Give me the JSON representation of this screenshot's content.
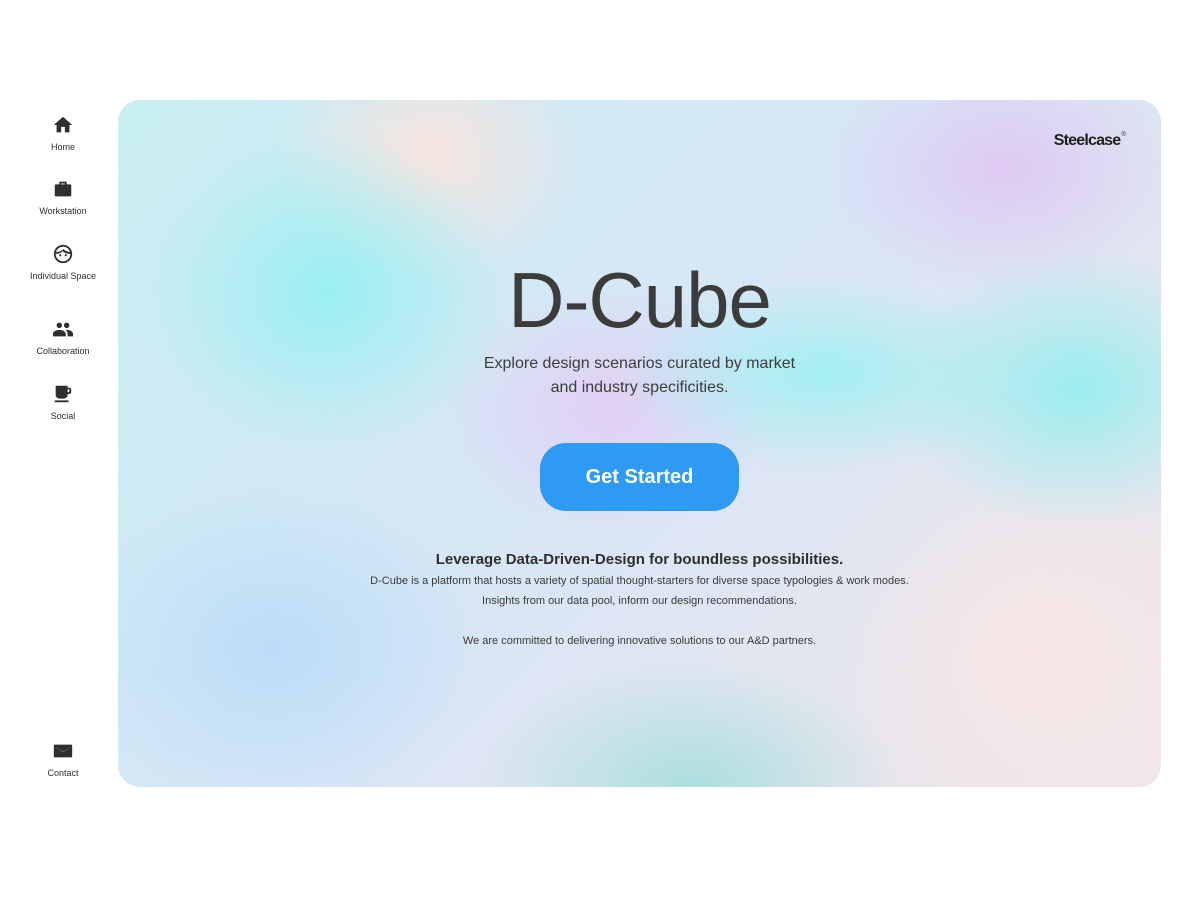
{
  "sidebar": {
    "items": [
      {
        "label": "Home",
        "icon": "home-icon"
      },
      {
        "label": "Workstation",
        "icon": "briefcase-icon"
      },
      {
        "label": "Individual Space",
        "icon": "face-icon"
      },
      {
        "label": "Collaboration",
        "icon": "people-icon"
      },
      {
        "label": "Social",
        "icon": "coffee-icon"
      }
    ],
    "contact": {
      "label": "Contact",
      "icon": "mail-icon"
    }
  },
  "hero": {
    "brand": "Steelcase",
    "brand_mark": "®",
    "title": "D-Cube",
    "subtitle_line1": "Explore design scenarios curated by market",
    "subtitle_line2": "and industry specificities.",
    "cta_label": "Get Started",
    "lede": "Leverage Data-Driven-Design for boundless possibilities.",
    "desc_line1": "D-Cube is a platform that hosts a variety of spatial thought-starters for diverse space typologies & work modes.",
    "desc_line2": "Insights from our data pool, inform our design recommendations.",
    "desc_line3": "We are committed to delivering innovative solutions to our A&D partners."
  },
  "colors": {
    "accent": "#2f9af3",
    "text": "#3c3c3c",
    "icon": "#2f2f2f"
  }
}
